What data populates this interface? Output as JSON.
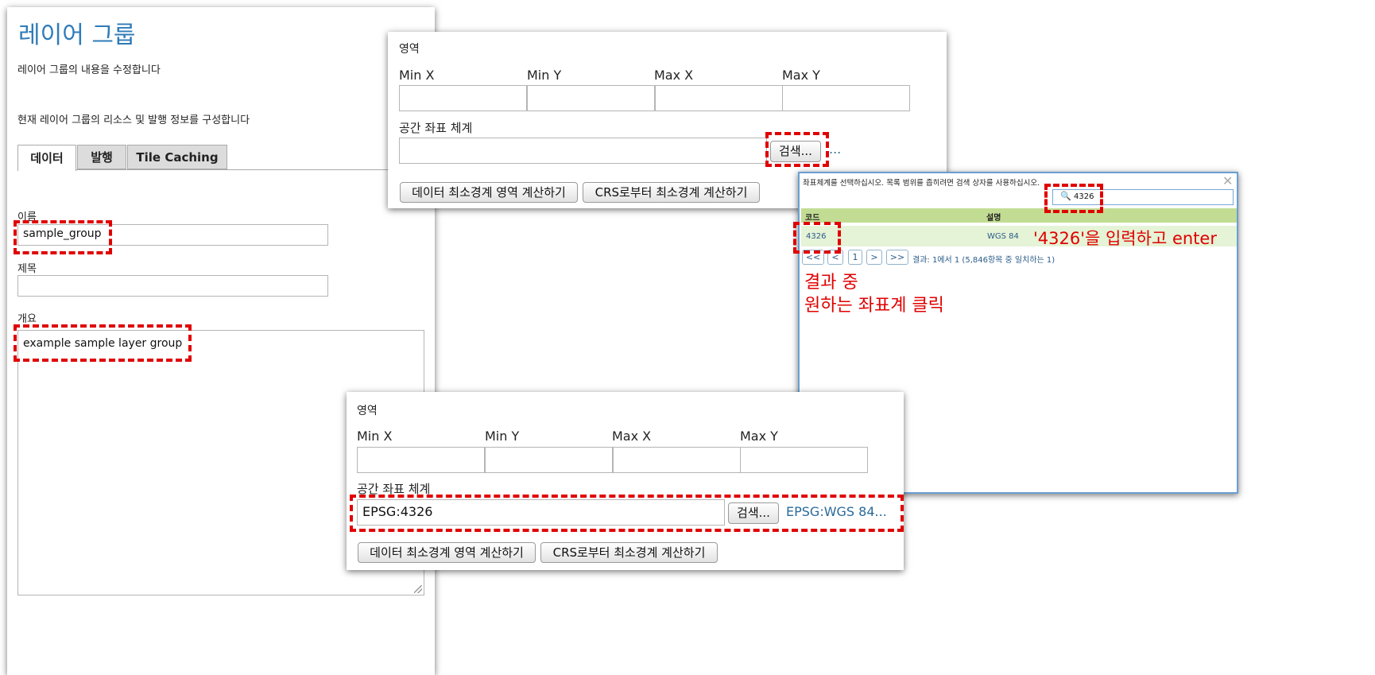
{
  "layer_group_form": {
    "title": "레이어 그룹",
    "subtitle": "레이어 그룹의 내용을 수정합니다",
    "description": "현재 레이어 그룹의 리소스 및 발행 정보를 구성합니다",
    "tabs": [
      "데이터",
      "발행",
      "Tile Caching"
    ],
    "name_label": "이름",
    "name_value": "sample_group",
    "title_label": "제목",
    "title_value": "",
    "abstract_label": "개요",
    "abstract_value": "example sample layer group"
  },
  "bounds_panel_top": {
    "section_label": "영역",
    "col_labels": [
      "Min X",
      "Min Y",
      "Max X",
      "Max Y"
    ],
    "srs_label": "공간 좌표 체계",
    "srs_value": "",
    "search_button": "검색...",
    "srs_display": "...",
    "compute_data_bounds_button": "데이터 최소경계 영역 계산하기",
    "compute_crs_bounds_button": "CRS로부터 최소경계 계산하기"
  },
  "srs_dialog": {
    "header": "좌표체계를 선택하십시오. 목록 범위를 좁히려면 검색 상자를 사용하십시오.",
    "search_value": "4326",
    "columns": [
      "코드",
      "설명"
    ],
    "rows": [
      {
        "code": "4326",
        "desc": "WGS 84"
      }
    ],
    "pagination": [
      "<<",
      "<",
      "1",
      ">",
      ">>"
    ],
    "result_text": "결과: 1에서 1 (5,846항목 중 일치하는 1)"
  },
  "bounds_panel_bottom": {
    "section_label": "영역",
    "col_labels": [
      "Min X",
      "Min Y",
      "Max X",
      "Max Y"
    ],
    "srs_label": "공간 좌표 체계",
    "srs_value": "EPSG:4326",
    "search_button": "검색...",
    "srs_display": "EPSG:WGS 84...",
    "compute_data_bounds_button": "데이터 최소경계 영역 계산하기",
    "compute_crs_bounds_button": "CRS로부터 최소경계 계산하기"
  },
  "annotations": {
    "enter_hint": "'4326'을 입력하고 enter",
    "result_hint_line1": "결과 중",
    "result_hint_line2": "원하는 좌표계 클릭"
  },
  "colors": {
    "title_blue": "#2f7bb8",
    "annotation_red": "#e00000",
    "table_header_green": "#c2dd93",
    "selected_row_green": "#e5f3d6",
    "link_blue": "#2a6a9a"
  }
}
